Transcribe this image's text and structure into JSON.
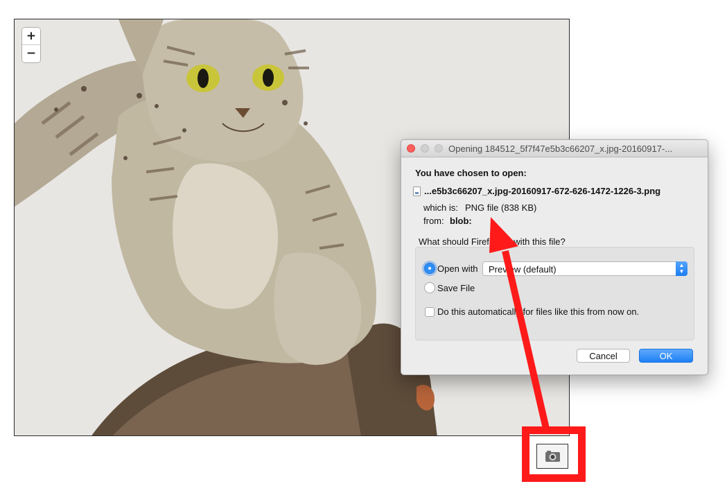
{
  "viewer": {
    "zoom_in": "+",
    "zoom_out": "−"
  },
  "dialog": {
    "title": "Opening 184512_5f7f47e5b3c66207_x.jpg-20160917-...",
    "heading": "You have chosen to open:",
    "filename": "...e5b3c66207_x.jpg-20160917-672-626-1472-1226-3.png",
    "which_is_label": "which is:",
    "which_is_value": "PNG file (838 KB)",
    "from_label": "from:",
    "from_value": "blob:",
    "question": "What should Firefox do with this file?",
    "open_with_label": "Open with",
    "open_with_app": "Preview (default)",
    "open_with_selected": true,
    "save_file_label": "Save File",
    "auto_label": "Do this automatically for files like this from now on.",
    "auto_checked": false,
    "cancel_label": "Cancel",
    "ok_label": "OK"
  },
  "annotation": {
    "arrow_color": "#ff1a1a",
    "highlight_color": "#ff1a1a"
  },
  "icons": [
    "zoom-in-icon",
    "zoom-out-icon",
    "camera-icon",
    "file-icon",
    "chevron-updown-icon"
  ]
}
